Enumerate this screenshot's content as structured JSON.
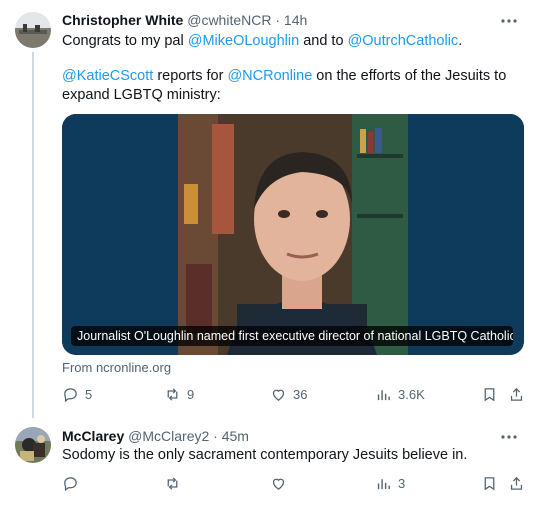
{
  "tweets": [
    {
      "name": "Christopher White",
      "handle": "@cwhiteNCR",
      "time": "14h",
      "text_line1_pre": "Congrats to my pal ",
      "mention1": "@MikeOLoughlin",
      "text_line1_mid": " and to ",
      "mention2": "@OutrchCatholic",
      "text_line1_post": ".",
      "mention3": "@KatieCScott",
      "text_line2_mid": " reports for ",
      "mention4": "@NCRonline",
      "text_line2_post": " on the efforts of the Jesuits to",
      "text_line3": "expand LGBTQ ministry:",
      "card_caption": "Journalist O'Loughlin named first executive director of national LGBTQ Catholic...",
      "card_source": "From ncronline.org",
      "replies": "5",
      "retweets": "9",
      "likes": "36",
      "views": "3.6K"
    },
    {
      "name": "McClarey",
      "handle": "@McClarey2",
      "time": "45m",
      "text": "Sodomy is the only sacrament contemporary Jesuits believe in.",
      "views": "3"
    }
  ],
  "icons": {
    "reply": "reply-icon",
    "retweet": "retweet-icon",
    "like": "like-icon",
    "views": "views-icon",
    "bookmark": "bookmark-icon",
    "share": "share-icon",
    "more": "more-icon"
  },
  "colors": {
    "link": "#1d9bf0",
    "muted": "#536471",
    "text": "#0f1419",
    "card_bg": "#0e3a5c"
  }
}
